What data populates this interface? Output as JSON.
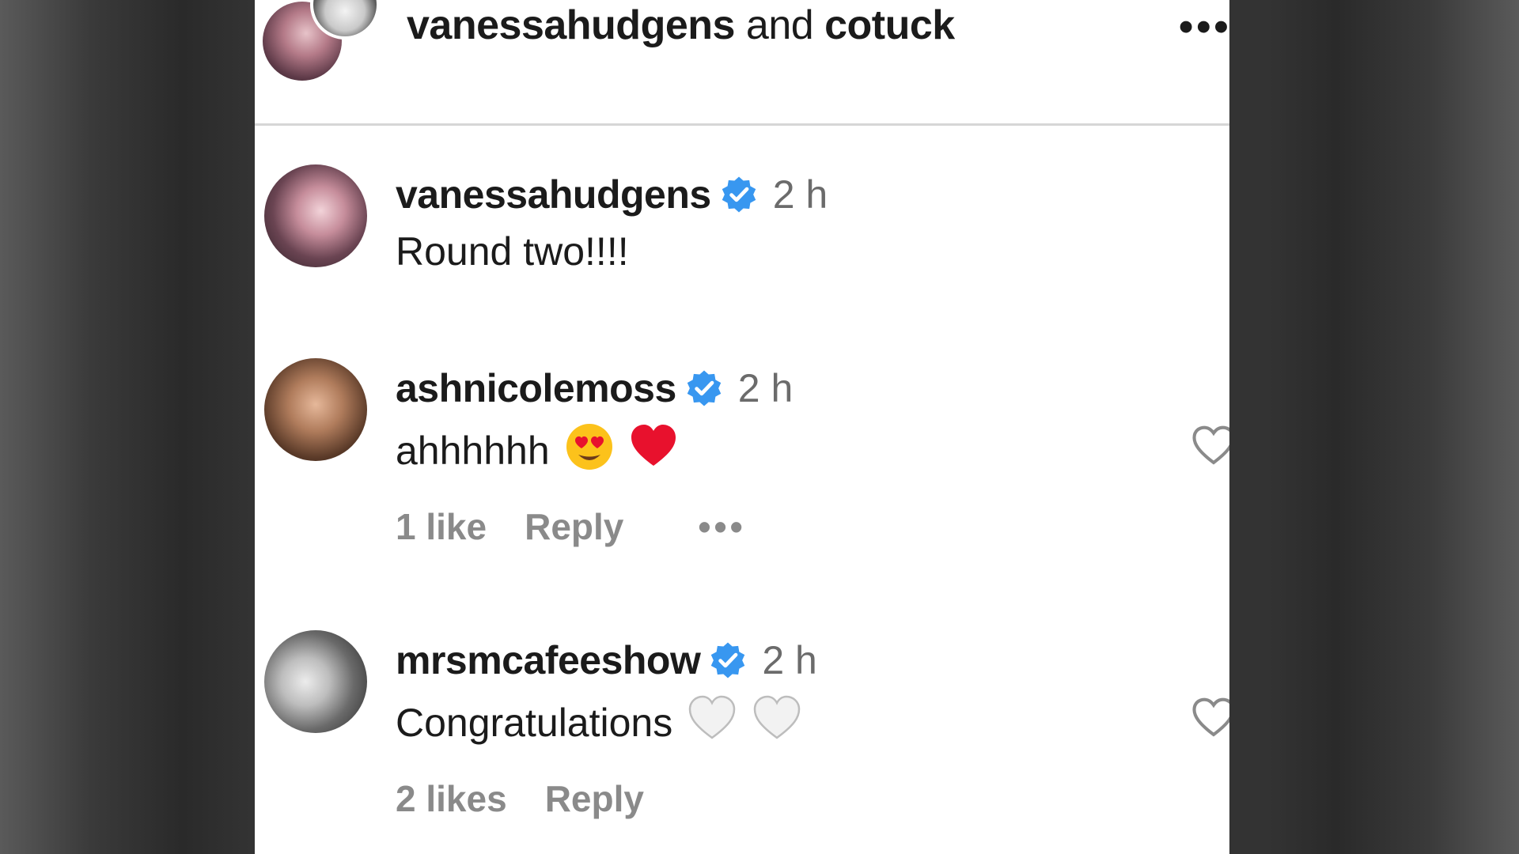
{
  "header": {
    "user1": "vanessahudgens",
    "and_text": "and",
    "user2": "cotuck",
    "more_icon": "more-horizontal-icon"
  },
  "comments": [
    {
      "username": "vanessahudgens",
      "verified": true,
      "time": "2 h",
      "text": "Round two!!!!"
    },
    {
      "username": "ashnicolemoss",
      "verified": true,
      "time": "2 h",
      "text": "ahhhhhh",
      "emojis": [
        "heart-eyes-emoji",
        "red-heart-emoji"
      ],
      "likes": "1 like",
      "reply": "Reply"
    },
    {
      "username": "mrsmcafeeshow",
      "verified": true,
      "time": "2 h",
      "text": "Congratulations",
      "emojis": [
        "white-heart-emoji",
        "white-heart-emoji"
      ],
      "likes": "2 likes",
      "reply": "Reply"
    }
  ],
  "colors": {
    "verified_blue": "#3897f0",
    "text_primary": "#1b1b1b",
    "text_secondary": "#8a8a8a",
    "heart_red": "#e8112d"
  }
}
